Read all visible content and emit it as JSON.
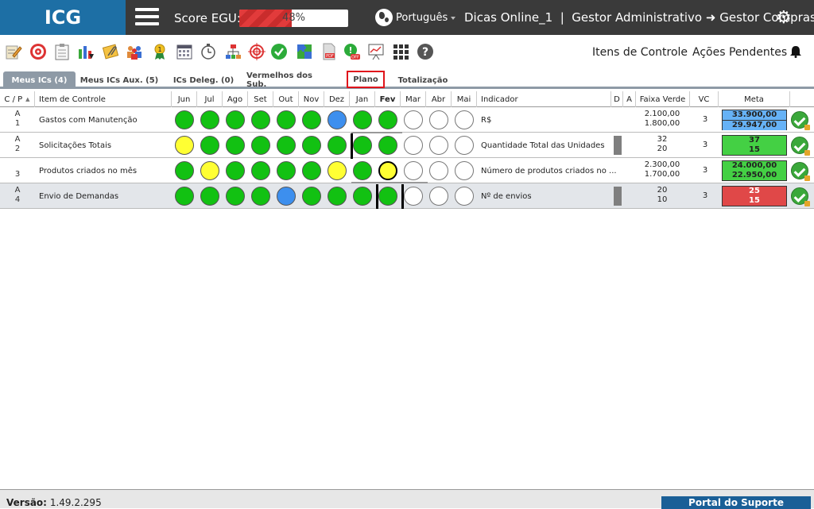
{
  "header": {
    "logo": "ICG",
    "score_label": "Score EGU:",
    "score_value": "48%",
    "score_percent": 48,
    "language": "Português",
    "user_text": "Dicas Online_1  |  Gestor Administrativo",
    "role_target": "Gestor Compras",
    "brand_color": "#1d6fa5"
  },
  "toolbar": {
    "icons": [
      "edit-icon",
      "target-icon",
      "clipboard-icon",
      "chart-down-icon",
      "paperclip-icon",
      "team-icon",
      "award-icon",
      "calendar-icon",
      "stopwatch-icon",
      "hierarchy-icon",
      "crosshair-icon",
      "check-circle-icon",
      "puzzle-icon",
      "pdf-icon",
      "alert-off-icon",
      "presentation-icon",
      "grid-apps-icon",
      "help-icon"
    ],
    "itens_controle": "Itens de Controle",
    "acoes_pendentes": "Ações Pendentes"
  },
  "tabs": [
    {
      "label": "Meus ICs (4)",
      "active": true
    },
    {
      "label": "Meus ICs Aux. (5)",
      "active": false
    },
    {
      "label": "ICs Deleg. (0)",
      "active": false
    },
    {
      "label": "Vermelhos dos Sub.",
      "active": false
    },
    {
      "label": "Plano",
      "active": false,
      "highlighted": true
    },
    {
      "label": "Totalização",
      "active": false
    }
  ],
  "columns": {
    "cp": "C / P",
    "item": "Item de Controle",
    "months": [
      "Jun",
      "Jul",
      "Ago",
      "Set",
      "Out",
      "Nov",
      "Dez",
      "Jan",
      "Fev",
      "Mar",
      "Abr",
      "Mai"
    ],
    "indicador": "Indicador",
    "d": "D",
    "a": "A",
    "faixa": "Faixa Verde",
    "vc": "VC",
    "meta": "Meta"
  },
  "rows": [
    {
      "c": "A",
      "p": "1",
      "item": "Gastos com Manutenção",
      "status": [
        "green",
        "green",
        "green",
        "green",
        "green",
        "green",
        "blue",
        "green",
        "green",
        "white",
        "white",
        "white"
      ],
      "indicador": "R$",
      "d_mark": false,
      "faixa_top": "2.100,00",
      "faixa_bottom": "1.800,00",
      "vc": "3",
      "meta_top": "33.900,00",
      "meta_bottom": "29.947,00",
      "meta_color": "blue"
    },
    {
      "c": "A",
      "p": "2",
      "item": "Solicitações Totais",
      "status": [
        "yellow",
        "green",
        "green",
        "green",
        "green",
        "green",
        "green",
        "green",
        "green",
        "white",
        "white",
        "white"
      ],
      "indicador": "Quantidade Total das Unidades",
      "d_mark": true,
      "faixa_top": "32",
      "faixa_bottom": "20",
      "vc": "3",
      "meta_top": "37",
      "meta_bottom": "15",
      "meta_color": "green"
    },
    {
      "c": "",
      "p": "3",
      "item": "Produtos criados no mês",
      "status": [
        "green",
        "yellow",
        "green",
        "green",
        "green",
        "green",
        "yellow",
        "green",
        "yellow",
        "white",
        "white",
        "white"
      ],
      "indicador": "Número de produtos criados no ...",
      "d_mark": false,
      "faixa_top": "2.300,00",
      "faixa_bottom": "1.700,00",
      "vc": "3",
      "meta_top": "24.000,00",
      "meta_bottom": "22.950,00",
      "meta_color": "green"
    },
    {
      "c": "A",
      "p": "4",
      "item": "Envio de Demandas",
      "status": [
        "green",
        "green",
        "green",
        "green",
        "blue",
        "green",
        "green",
        "green",
        "green",
        "white",
        "white",
        "white"
      ],
      "indicador": "Nº de envios",
      "d_mark": true,
      "faixa_top": "20",
      "faixa_bottom": "10",
      "vc": "3",
      "meta_top": "25",
      "meta_bottom": "15",
      "meta_color": "red"
    }
  ],
  "footer": {
    "version_label": "Versão:",
    "version": "1.49.2.295",
    "portal": "Portal do Suporte"
  }
}
